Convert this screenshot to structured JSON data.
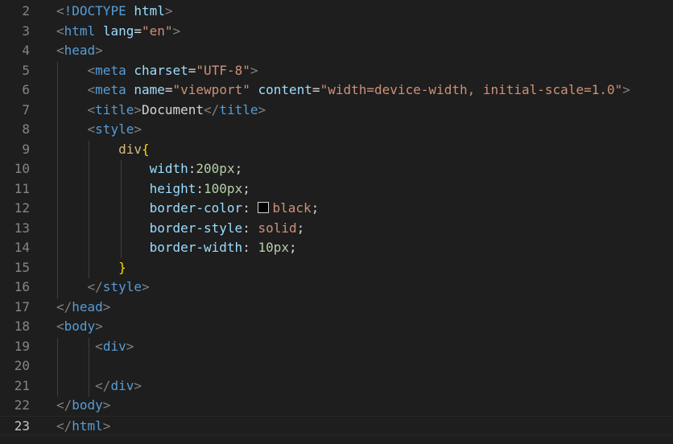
{
  "editor": {
    "active_line": 23,
    "colors": {
      "background": "#1e1e1e",
      "tag": "#569cd6",
      "attribute": "#9cdcfe",
      "string": "#ce9178",
      "selector": "#d7ba7d",
      "brace": "#ffd700",
      "number": "#b5cea8",
      "text": "#d4d4d4",
      "punctuation": "#808080",
      "line_number": "#858585"
    },
    "lines": [
      {
        "n": "2",
        "indent": "",
        "tokens": [
          [
            "p",
            "<"
          ],
          [
            "tg",
            "!DOCTYPE"
          ],
          [
            "tx",
            " "
          ],
          [
            "at",
            "html"
          ],
          [
            "p",
            ">"
          ]
        ]
      },
      {
        "n": "3",
        "indent": "",
        "tokens": [
          [
            "p",
            "<"
          ],
          [
            "tg",
            "html"
          ],
          [
            "tx",
            " "
          ],
          [
            "at",
            "lang"
          ],
          [
            "tx",
            "="
          ],
          [
            "s",
            "\"en\""
          ],
          [
            "p",
            ">"
          ]
        ]
      },
      {
        "n": "4",
        "indent": "",
        "tokens": [
          [
            "p",
            "<"
          ],
          [
            "tg",
            "head"
          ],
          [
            "p",
            ">"
          ]
        ]
      },
      {
        "n": "5",
        "indent": "    ",
        "tokens": [
          [
            "p",
            "<"
          ],
          [
            "tg",
            "meta"
          ],
          [
            "tx",
            " "
          ],
          [
            "at",
            "charset"
          ],
          [
            "tx",
            "="
          ],
          [
            "s",
            "\"UTF-8\""
          ],
          [
            "p",
            ">"
          ]
        ]
      },
      {
        "n": "6",
        "indent": "    ",
        "tokens": [
          [
            "p",
            "<"
          ],
          [
            "tg",
            "meta"
          ],
          [
            "tx",
            " "
          ],
          [
            "at",
            "name"
          ],
          [
            "tx",
            "="
          ],
          [
            "s",
            "\"viewport\""
          ],
          [
            "tx",
            " "
          ],
          [
            "at",
            "content"
          ],
          [
            "tx",
            "="
          ],
          [
            "s",
            "\"width=device-width, initial-scale=1.0\""
          ],
          [
            "p",
            ">"
          ]
        ]
      },
      {
        "n": "7",
        "indent": "    ",
        "tokens": [
          [
            "p",
            "<"
          ],
          [
            "tg",
            "title"
          ],
          [
            "p",
            ">"
          ],
          [
            "tx",
            "Document"
          ],
          [
            "p",
            "</"
          ],
          [
            "tg",
            "title"
          ],
          [
            "p",
            ">"
          ]
        ]
      },
      {
        "n": "8",
        "indent": "    ",
        "tokens": [
          [
            "p",
            "<"
          ],
          [
            "tg",
            "style"
          ],
          [
            "p",
            ">"
          ]
        ]
      },
      {
        "n": "9",
        "indent": "        ",
        "tokens": [
          [
            "sel",
            "div"
          ],
          [
            "br",
            "{"
          ]
        ]
      },
      {
        "n": "10",
        "indent": "            ",
        "tokens": [
          [
            "at",
            "width"
          ],
          [
            "tx",
            ":"
          ],
          [
            "num",
            "200px"
          ],
          [
            "tx",
            ";"
          ]
        ]
      },
      {
        "n": "11",
        "indent": "            ",
        "tokens": [
          [
            "at",
            "height"
          ],
          [
            "tx",
            ":"
          ],
          [
            "num",
            "100px"
          ],
          [
            "tx",
            ";"
          ]
        ]
      },
      {
        "n": "12",
        "indent": "            ",
        "tokens": [
          [
            "at",
            "border-color"
          ],
          [
            "tx",
            ": "
          ],
          [
            "sw",
            ""
          ],
          [
            "s",
            "black"
          ],
          [
            "tx",
            ";"
          ]
        ]
      },
      {
        "n": "13",
        "indent": "            ",
        "tokens": [
          [
            "at",
            "border-style"
          ],
          [
            "tx",
            ": "
          ],
          [
            "s",
            "solid"
          ],
          [
            "tx",
            ";"
          ]
        ]
      },
      {
        "n": "14",
        "indent": "            ",
        "tokens": [
          [
            "at",
            "border-width"
          ],
          [
            "tx",
            ": "
          ],
          [
            "num",
            "10px"
          ],
          [
            "tx",
            ";"
          ]
        ]
      },
      {
        "n": "15",
        "indent": "        ",
        "tokens": [
          [
            "br",
            "}"
          ]
        ]
      },
      {
        "n": "16",
        "indent": "    ",
        "tokens": [
          [
            "p",
            "</"
          ],
          [
            "tg",
            "style"
          ],
          [
            "p",
            ">"
          ]
        ]
      },
      {
        "n": "17",
        "indent": "",
        "tokens": [
          [
            "p",
            "</"
          ],
          [
            "tg",
            "head"
          ],
          [
            "p",
            ">"
          ]
        ]
      },
      {
        "n": "18",
        "indent": "",
        "tokens": [
          [
            "p",
            "<"
          ],
          [
            "tg",
            "body"
          ],
          [
            "p",
            ">"
          ]
        ]
      },
      {
        "n": "19",
        "indent": "     ",
        "tokens": [
          [
            "p",
            "<"
          ],
          [
            "tg",
            "div"
          ],
          [
            "p",
            ">"
          ]
        ]
      },
      {
        "n": "20",
        "indent": "",
        "tokens": []
      },
      {
        "n": "21",
        "indent": "     ",
        "tokens": [
          [
            "p",
            "</"
          ],
          [
            "tg",
            "div"
          ],
          [
            "p",
            ">"
          ]
        ]
      },
      {
        "n": "22",
        "indent": "",
        "tokens": [
          [
            "p",
            "</"
          ],
          [
            "tg",
            "body"
          ],
          [
            "p",
            ">"
          ]
        ]
      },
      {
        "n": "23",
        "indent": "",
        "tokens": [
          [
            "p",
            "</"
          ],
          [
            "tg",
            "html"
          ],
          [
            "p",
            ">"
          ]
        ]
      }
    ]
  }
}
